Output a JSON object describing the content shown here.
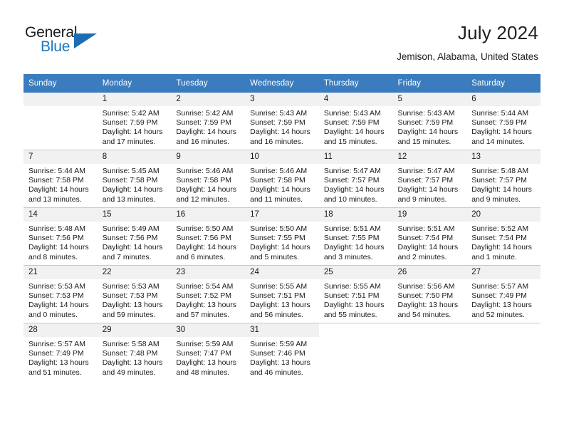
{
  "brand": {
    "word1": "General",
    "word2": "Blue",
    "triangle_color": "#1c6eb4",
    "blue_text_color": "#1c78c0"
  },
  "header": {
    "title": "July 2024",
    "subtitle": "Jemison, Alabama, United States",
    "header_bg": "#3a7cbe",
    "daynum_bg": "#f1f1f1"
  },
  "calendar": {
    "weekday_headers": [
      "Sunday",
      "Monday",
      "Tuesday",
      "Wednesday",
      "Thursday",
      "Friday",
      "Saturday"
    ],
    "weeks": [
      [
        {
          "day": "",
          "blank": true,
          "sunrise": "",
          "sunset": "",
          "daylight1": "",
          "daylight2": ""
        },
        {
          "day": "1",
          "sunrise": "Sunrise: 5:42 AM",
          "sunset": "Sunset: 7:59 PM",
          "daylight1": "Daylight: 14 hours",
          "daylight2": "and 17 minutes."
        },
        {
          "day": "2",
          "sunrise": "Sunrise: 5:42 AM",
          "sunset": "Sunset: 7:59 PM",
          "daylight1": "Daylight: 14 hours",
          "daylight2": "and 16 minutes."
        },
        {
          "day": "3",
          "sunrise": "Sunrise: 5:43 AM",
          "sunset": "Sunset: 7:59 PM",
          "daylight1": "Daylight: 14 hours",
          "daylight2": "and 16 minutes."
        },
        {
          "day": "4",
          "sunrise": "Sunrise: 5:43 AM",
          "sunset": "Sunset: 7:59 PM",
          "daylight1": "Daylight: 14 hours",
          "daylight2": "and 15 minutes."
        },
        {
          "day": "5",
          "sunrise": "Sunrise: 5:43 AM",
          "sunset": "Sunset: 7:59 PM",
          "daylight1": "Daylight: 14 hours",
          "daylight2": "and 15 minutes."
        },
        {
          "day": "6",
          "sunrise": "Sunrise: 5:44 AM",
          "sunset": "Sunset: 7:59 PM",
          "daylight1": "Daylight: 14 hours",
          "daylight2": "and 14 minutes."
        }
      ],
      [
        {
          "day": "7",
          "sunrise": "Sunrise: 5:44 AM",
          "sunset": "Sunset: 7:58 PM",
          "daylight1": "Daylight: 14 hours",
          "daylight2": "and 13 minutes."
        },
        {
          "day": "8",
          "sunrise": "Sunrise: 5:45 AM",
          "sunset": "Sunset: 7:58 PM",
          "daylight1": "Daylight: 14 hours",
          "daylight2": "and 13 minutes."
        },
        {
          "day": "9",
          "sunrise": "Sunrise: 5:46 AM",
          "sunset": "Sunset: 7:58 PM",
          "daylight1": "Daylight: 14 hours",
          "daylight2": "and 12 minutes."
        },
        {
          "day": "10",
          "sunrise": "Sunrise: 5:46 AM",
          "sunset": "Sunset: 7:58 PM",
          "daylight1": "Daylight: 14 hours",
          "daylight2": "and 11 minutes."
        },
        {
          "day": "11",
          "sunrise": "Sunrise: 5:47 AM",
          "sunset": "Sunset: 7:57 PM",
          "daylight1": "Daylight: 14 hours",
          "daylight2": "and 10 minutes."
        },
        {
          "day": "12",
          "sunrise": "Sunrise: 5:47 AM",
          "sunset": "Sunset: 7:57 PM",
          "daylight1": "Daylight: 14 hours",
          "daylight2": "and 9 minutes."
        },
        {
          "day": "13",
          "sunrise": "Sunrise: 5:48 AM",
          "sunset": "Sunset: 7:57 PM",
          "daylight1": "Daylight: 14 hours",
          "daylight2": "and 9 minutes."
        }
      ],
      [
        {
          "day": "14",
          "sunrise": "Sunrise: 5:48 AM",
          "sunset": "Sunset: 7:56 PM",
          "daylight1": "Daylight: 14 hours",
          "daylight2": "and 8 minutes."
        },
        {
          "day": "15",
          "sunrise": "Sunrise: 5:49 AM",
          "sunset": "Sunset: 7:56 PM",
          "daylight1": "Daylight: 14 hours",
          "daylight2": "and 7 minutes."
        },
        {
          "day": "16",
          "sunrise": "Sunrise: 5:50 AM",
          "sunset": "Sunset: 7:56 PM",
          "daylight1": "Daylight: 14 hours",
          "daylight2": "and 6 minutes."
        },
        {
          "day": "17",
          "sunrise": "Sunrise: 5:50 AM",
          "sunset": "Sunset: 7:55 PM",
          "daylight1": "Daylight: 14 hours",
          "daylight2": "and 5 minutes."
        },
        {
          "day": "18",
          "sunrise": "Sunrise: 5:51 AM",
          "sunset": "Sunset: 7:55 PM",
          "daylight1": "Daylight: 14 hours",
          "daylight2": "and 3 minutes."
        },
        {
          "day": "19",
          "sunrise": "Sunrise: 5:51 AM",
          "sunset": "Sunset: 7:54 PM",
          "daylight1": "Daylight: 14 hours",
          "daylight2": "and 2 minutes."
        },
        {
          "day": "20",
          "sunrise": "Sunrise: 5:52 AM",
          "sunset": "Sunset: 7:54 PM",
          "daylight1": "Daylight: 14 hours",
          "daylight2": "and 1 minute."
        }
      ],
      [
        {
          "day": "21",
          "sunrise": "Sunrise: 5:53 AM",
          "sunset": "Sunset: 7:53 PM",
          "daylight1": "Daylight: 14 hours",
          "daylight2": "and 0 minutes."
        },
        {
          "day": "22",
          "sunrise": "Sunrise: 5:53 AM",
          "sunset": "Sunset: 7:53 PM",
          "daylight1": "Daylight: 13 hours",
          "daylight2": "and 59 minutes."
        },
        {
          "day": "23",
          "sunrise": "Sunrise: 5:54 AM",
          "sunset": "Sunset: 7:52 PM",
          "daylight1": "Daylight: 13 hours",
          "daylight2": "and 57 minutes."
        },
        {
          "day": "24",
          "sunrise": "Sunrise: 5:55 AM",
          "sunset": "Sunset: 7:51 PM",
          "daylight1": "Daylight: 13 hours",
          "daylight2": "and 56 minutes."
        },
        {
          "day": "25",
          "sunrise": "Sunrise: 5:55 AM",
          "sunset": "Sunset: 7:51 PM",
          "daylight1": "Daylight: 13 hours",
          "daylight2": "and 55 minutes."
        },
        {
          "day": "26",
          "sunrise": "Sunrise: 5:56 AM",
          "sunset": "Sunset: 7:50 PM",
          "daylight1": "Daylight: 13 hours",
          "daylight2": "and 54 minutes."
        },
        {
          "day": "27",
          "sunrise": "Sunrise: 5:57 AM",
          "sunset": "Sunset: 7:49 PM",
          "daylight1": "Daylight: 13 hours",
          "daylight2": "and 52 minutes."
        }
      ],
      [
        {
          "day": "28",
          "sunrise": "Sunrise: 5:57 AM",
          "sunset": "Sunset: 7:49 PM",
          "daylight1": "Daylight: 13 hours",
          "daylight2": "and 51 minutes."
        },
        {
          "day": "29",
          "sunrise": "Sunrise: 5:58 AM",
          "sunset": "Sunset: 7:48 PM",
          "daylight1": "Daylight: 13 hours",
          "daylight2": "and 49 minutes."
        },
        {
          "day": "30",
          "sunrise": "Sunrise: 5:59 AM",
          "sunset": "Sunset: 7:47 PM",
          "daylight1": "Daylight: 13 hours",
          "daylight2": "and 48 minutes."
        },
        {
          "day": "31",
          "sunrise": "Sunrise: 5:59 AM",
          "sunset": "Sunset: 7:46 PM",
          "daylight1": "Daylight: 13 hours",
          "daylight2": "and 46 minutes."
        },
        {
          "day": "",
          "blank": true,
          "sunrise": "",
          "sunset": "",
          "daylight1": "",
          "daylight2": ""
        },
        {
          "day": "",
          "blank": true,
          "sunrise": "",
          "sunset": "",
          "daylight1": "",
          "daylight2": ""
        },
        {
          "day": "",
          "blank": true,
          "sunrise": "",
          "sunset": "",
          "daylight1": "",
          "daylight2": ""
        }
      ]
    ]
  }
}
